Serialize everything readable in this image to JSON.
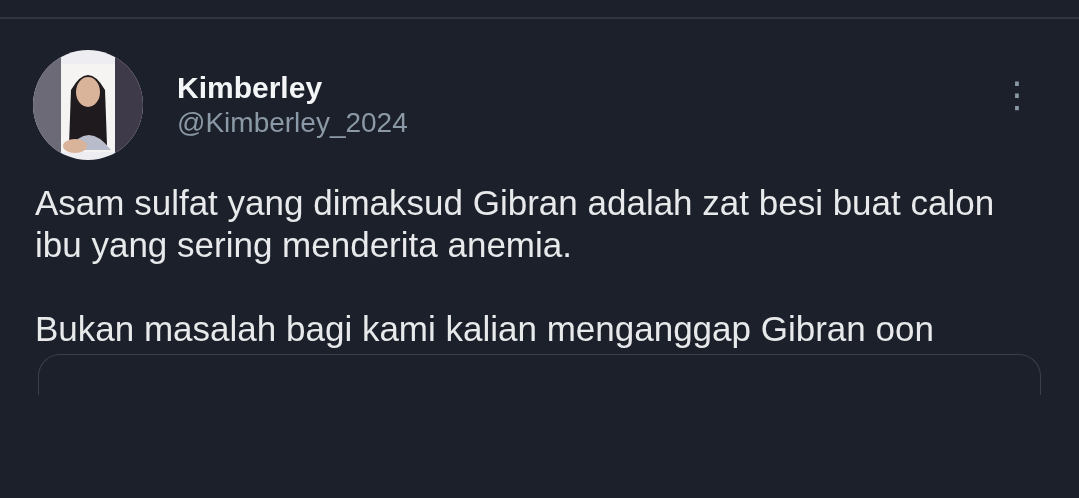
{
  "tweet": {
    "author": {
      "name": "Kimberley",
      "handle": "@Kimberley_2024"
    },
    "more_button": "⋮",
    "paragraphs": [
      "Asam sulfat yang dimaksud Gibran adalah zat besi buat calon ibu yang sering menderita anemia.",
      "Bukan masalah bagi kami kalian menganggap Gibran oon"
    ]
  }
}
